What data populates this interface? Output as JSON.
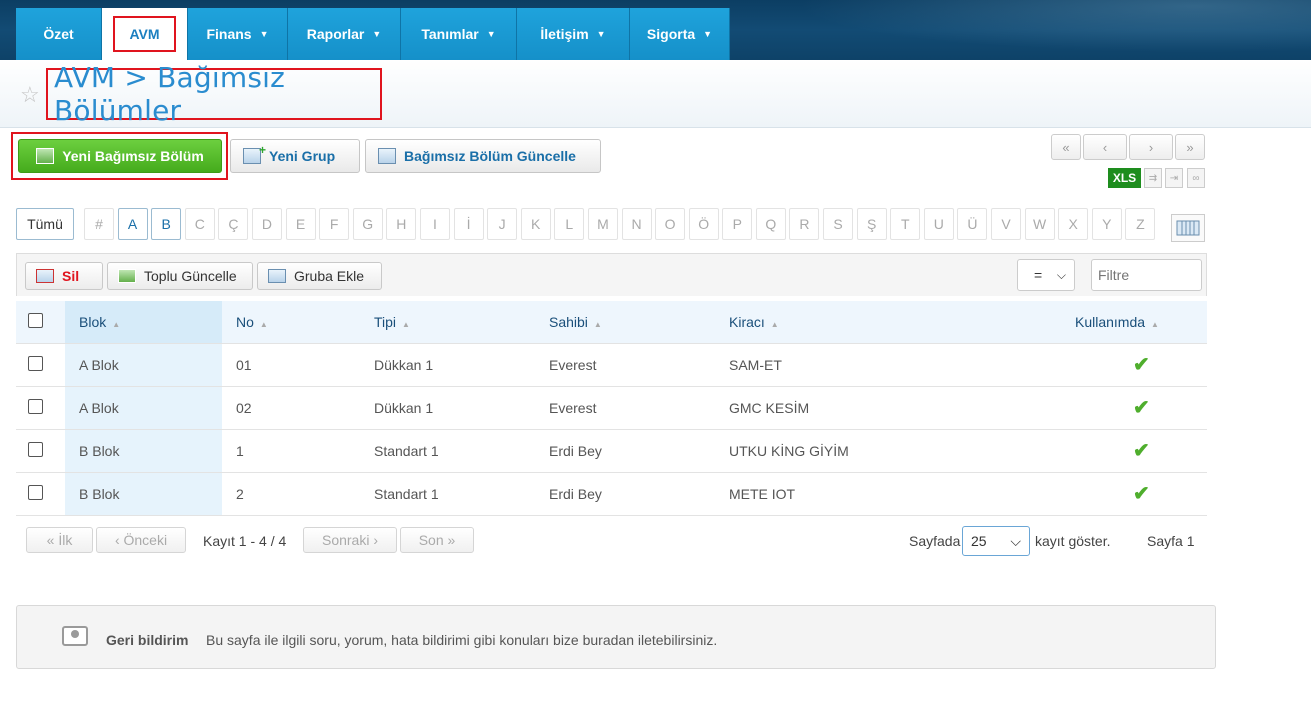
{
  "nav": {
    "items": [
      {
        "label": "Özet",
        "caret": ""
      },
      {
        "label": "AVM",
        "caret": ""
      },
      {
        "label": "Finans",
        "caret": "▼"
      },
      {
        "label": "Raporlar",
        "caret": "▼"
      },
      {
        "label": "Tanımlar",
        "caret": "▼"
      },
      {
        "label": "İletişim",
        "caret": "▼"
      },
      {
        "label": "Sigorta",
        "caret": "▼"
      }
    ]
  },
  "header": {
    "title": "AVM > Bağımsız Bölümler",
    "star_icon": "☆"
  },
  "actions": {
    "new_unit": "Yeni Bağımsız Bölüm",
    "new_group": "Yeni Grup",
    "update_unit": "Bağımsız Bölüm Güncelle"
  },
  "pager_top": {
    "first": "«",
    "prev": "‹",
    "next": "›",
    "last": "»",
    "xls": "XLS"
  },
  "letters": {
    "all": "Tümü",
    "items": [
      "#",
      "A",
      "B",
      "C",
      "Ç",
      "D",
      "E",
      "F",
      "G",
      "H",
      "I",
      "İ",
      "J",
      "K",
      "L",
      "M",
      "N",
      "O",
      "Ö",
      "P",
      "Q",
      "R",
      "S",
      "Ş",
      "T",
      "U",
      "Ü",
      "V",
      "W",
      "X",
      "Y",
      "Z"
    ]
  },
  "toolbar": {
    "delete": "Sil",
    "bulk_update": "Toplu Güncelle",
    "add_to_group": "Gruba Ekle",
    "operator": "=",
    "filter_placeholder": "Filtre"
  },
  "table": {
    "headers": [
      "Blok",
      "No",
      "Tipi",
      "Sahibi",
      "Kiracı",
      "Kullanımda"
    ],
    "rows": [
      {
        "blok": "A Blok",
        "no": "01",
        "tipi": "Dükkan 1",
        "sahibi": "Everest",
        "kiraci": "SAM-ET",
        "kullanimda": "✔"
      },
      {
        "blok": "A Blok",
        "no": "02",
        "tipi": "Dükkan 1",
        "sahibi": "Everest",
        "kiraci": "GMC KESİM",
        "kullanimda": "✔"
      },
      {
        "blok": "B Blok",
        "no": "1",
        "tipi": "Standart 1",
        "sahibi": "Erdi Bey",
        "kiraci": "UTKU KİNG GİYİM",
        "kullanimda": "✔"
      },
      {
        "blok": "B Blok",
        "no": "2",
        "tipi": "Standart 1",
        "sahibi": "Erdi Bey",
        "kiraci": "METE IOT",
        "kullanimda": "✔"
      }
    ]
  },
  "pager_bottom": {
    "first": "« İlk",
    "prev": "‹ Önceki",
    "record_info": "Kayıt 1 - 4 / 4",
    "next": "Sonraki ›",
    "last": "Son »",
    "page_label": "Sayfada",
    "page_size": "25",
    "show_label": "kayıt göster.",
    "page_info": "Sayfa 1"
  },
  "feedback": {
    "title": "Geri bildirim",
    "text": "Bu sayfa ile ilgili soru, yorum, hata bildirimi gibi konuları bize buradan iletebilirsiniz."
  }
}
